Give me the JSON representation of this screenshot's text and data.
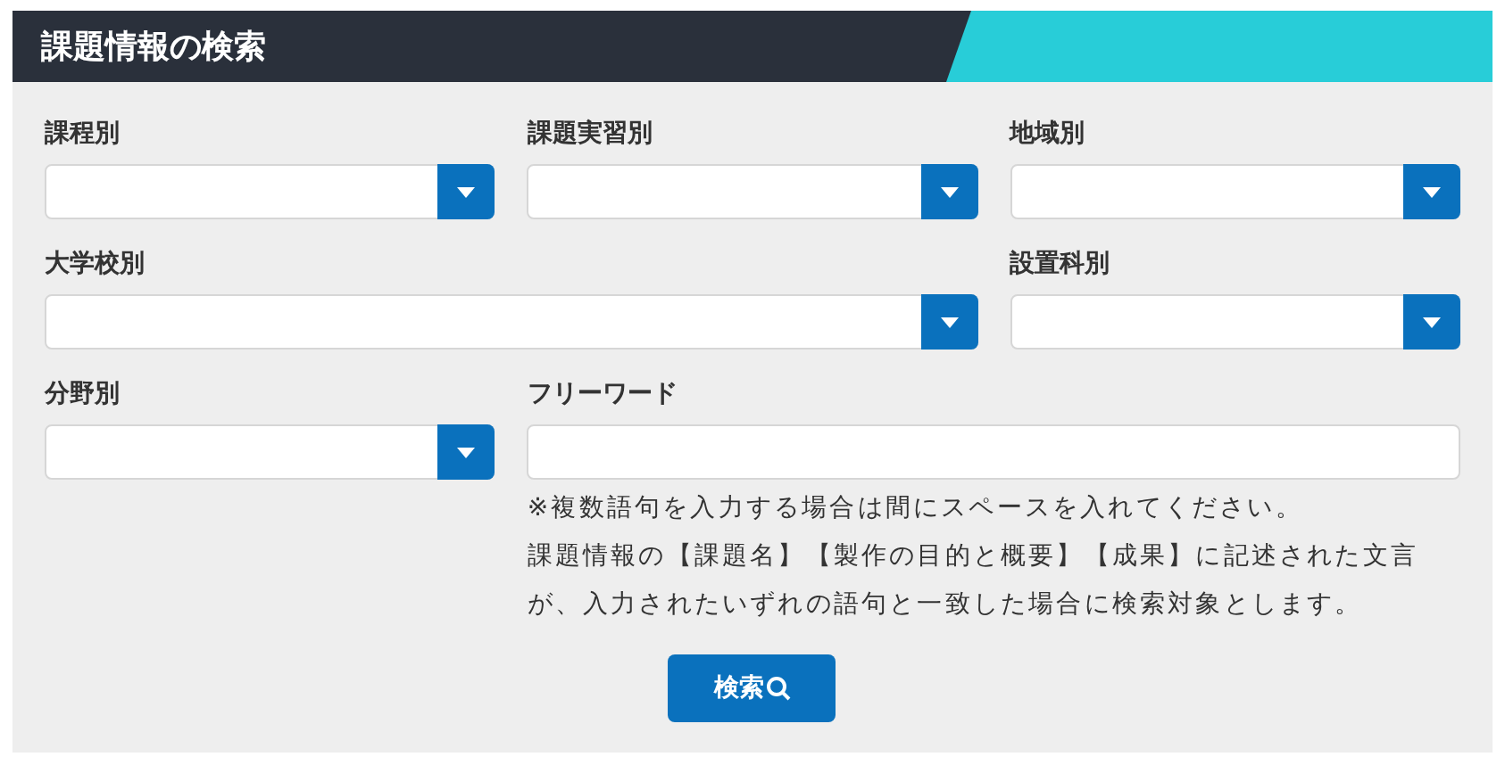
{
  "header": {
    "title": "課題情報の検索"
  },
  "fields": [
    {
      "kind": "select",
      "label": "課程別"
    },
    {
      "kind": "select",
      "label": "課題実習別"
    },
    {
      "kind": "select",
      "label": "地域別"
    },
    {
      "kind": "select",
      "label": "大学校別"
    },
    {
      "kind": "select",
      "label": "設置科別"
    },
    {
      "kind": "select",
      "label": "分野別"
    },
    {
      "kind": "text",
      "label": "フリーワード",
      "notes": [
        "※複数語句を入力する場合は間にスペースを入れてください。",
        "課題情報の【課題名】【製作の目的と概要】【成果】に記述された文言が、入力されたいずれの語句と一致した場合に検索対象とします。"
      ]
    }
  ],
  "search_button": {
    "label": "検索"
  }
}
